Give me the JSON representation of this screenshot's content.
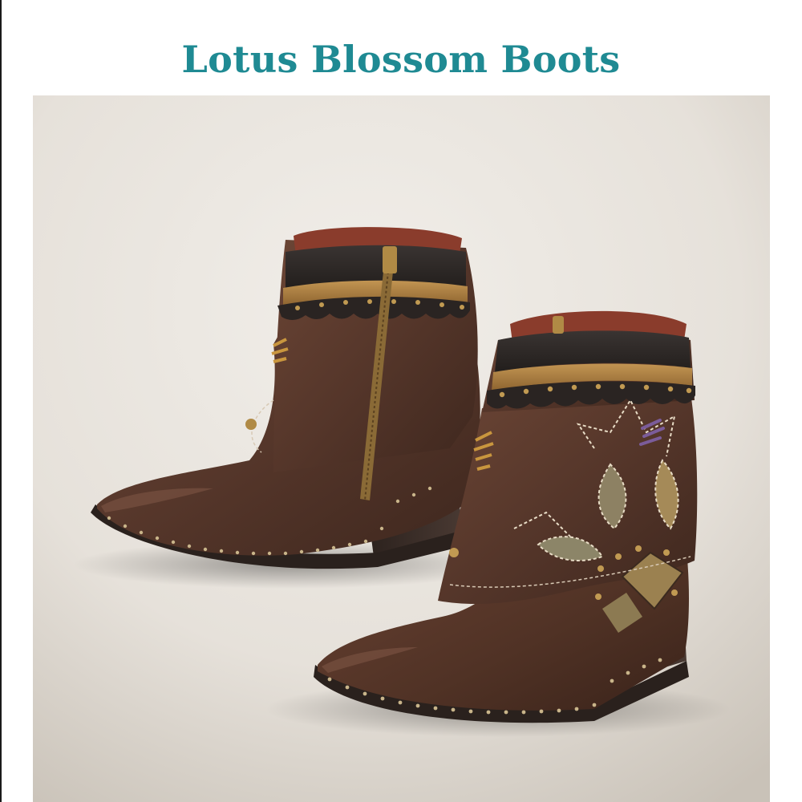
{
  "product": {
    "title": "Lotus Blossom Boots"
  },
  "image": {
    "subject": "pair-of-ankle-boots",
    "icon": "boots-image"
  },
  "colors": {
    "title": "#1f8a93",
    "background": "#ffffff",
    "backdrop": "#e9e5df",
    "suede": "#5a3a2c",
    "leather_band": "#2e2a28",
    "tan_band": "#a87a3c",
    "stud": "#b08a45"
  }
}
